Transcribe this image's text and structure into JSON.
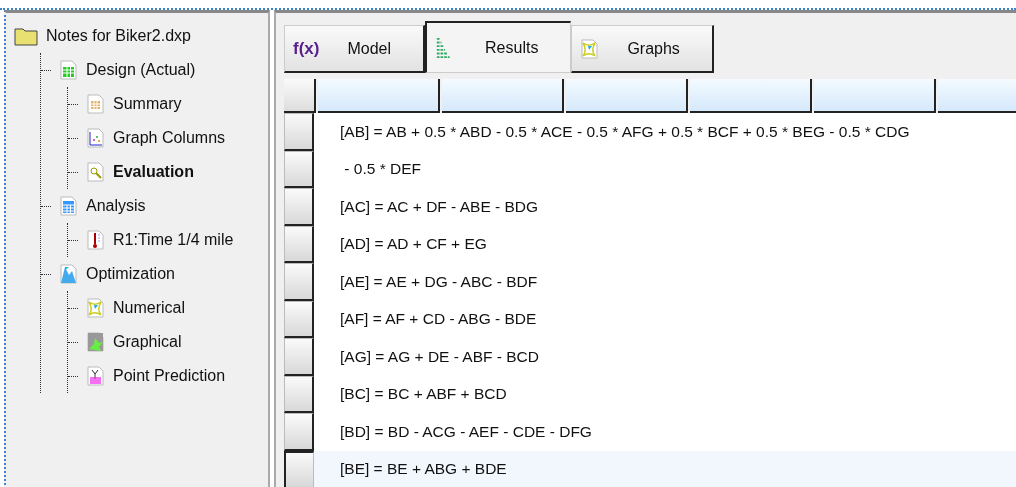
{
  "tree": {
    "label": "Notes for Biker2.dxp",
    "kind": "folder",
    "selected": false,
    "children": [
      {
        "label": "Design (Actual)",
        "kind": "spreadsheet",
        "selected": false,
        "children": [
          {
            "label": "Summary",
            "kind": "table",
            "selected": false
          },
          {
            "label": "Graph Columns",
            "kind": "scatter",
            "selected": false
          },
          {
            "label": "Evaluation",
            "kind": "magnifier",
            "selected": true
          }
        ]
      },
      {
        "label": "Analysis",
        "kind": "calculator",
        "selected": false,
        "children": [
          {
            "label": "R1:Time 1/4 mile",
            "kind": "thermometer",
            "selected": false
          }
        ]
      },
      {
        "label": "Optimization",
        "kind": "mountain",
        "selected": false,
        "children": [
          {
            "label": "Numerical",
            "kind": "contour",
            "selected": false
          },
          {
            "label": "Graphical",
            "kind": "blob",
            "selected": false
          },
          {
            "label": "Point Prediction",
            "kind": "point",
            "selected": false
          }
        ]
      }
    ]
  },
  "tabs": [
    {
      "label": "Model",
      "kind": "fx",
      "icon_text": "f(x)",
      "selected": false
    },
    {
      "label": "Results",
      "kind": "lines",
      "selected": true
    },
    {
      "label": "Graphs",
      "kind": "contour",
      "selected": false
    }
  ],
  "grid": {
    "rows": [
      {
        "text": "[AB] = AB + 0.5 * ABD - 0.5 * ACE - 0.5 * AFG + 0.5 * BCF + 0.5 * BEG - 0.5 * CDG",
        "selected": false
      },
      {
        "text": " - 0.5 * DEF",
        "selected": false
      },
      {
        "text": "[AC] = AC + DF - ABE - BDG",
        "selected": false
      },
      {
        "text": "[AD] = AD + CF + EG",
        "selected": false
      },
      {
        "text": "[AE] = AE + DG - ABC - BDF",
        "selected": false
      },
      {
        "text": "[AF] = AF + CD - ABG - BDE",
        "selected": false
      },
      {
        "text": "[AG] = AG + DE - ABF - BCD",
        "selected": false
      },
      {
        "text": "[BC] = BC + ABF + BCD",
        "selected": false
      },
      {
        "text": "[BD] = BD - ACG - AEF - CDE - DFG",
        "selected": false
      },
      {
        "text": "[BE] = BE + ABG + BDE",
        "selected": true
      }
    ]
  }
}
